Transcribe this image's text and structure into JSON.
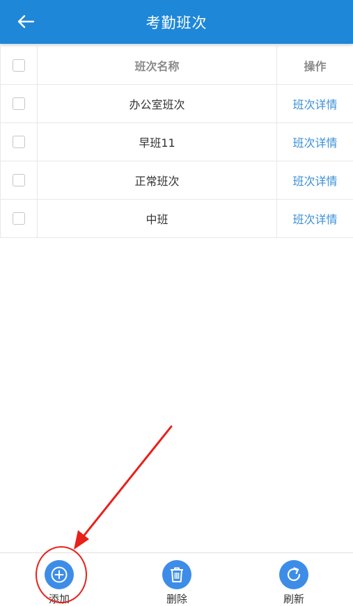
{
  "header": {
    "title": "考勤班次",
    "back_icon": "arrow-left-icon"
  },
  "table": {
    "columns": [
      "班次名称",
      "操作"
    ],
    "rows": [
      {
        "name": "办公室班次",
        "action": "班次详情"
      },
      {
        "name": "早班11",
        "action": "班次详情"
      },
      {
        "name": "正常班次",
        "action": "班次详情"
      },
      {
        "name": "中班",
        "action": "班次详情"
      }
    ]
  },
  "toolbar": {
    "add_label": "添加",
    "delete_label": "删除",
    "refresh_label": "刷新"
  },
  "colors": {
    "header_bg": "#1e87d8",
    "accent": "#3d8de8",
    "link": "#3a8fd6",
    "annotation": "#e8201a"
  }
}
